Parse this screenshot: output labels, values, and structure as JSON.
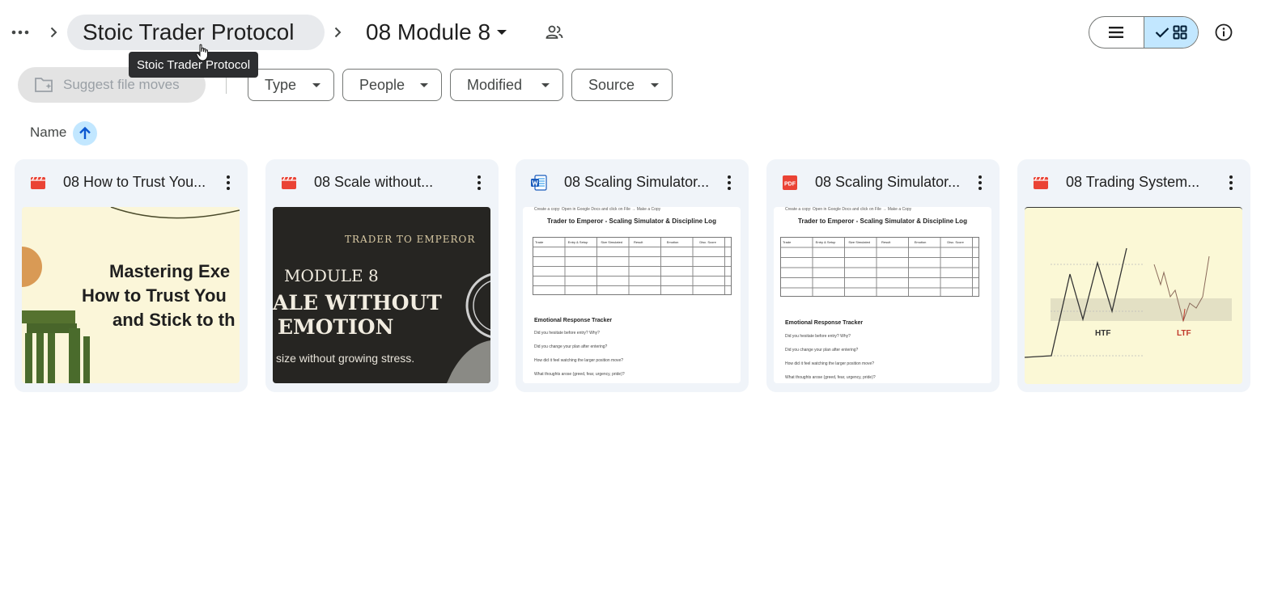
{
  "breadcrumb": {
    "root": "Stoic Trader Protocol",
    "current": "08 Module 8",
    "tooltip": "Stoic Trader Protocol"
  },
  "toolbar": {
    "suggest_label": "Suggest file moves",
    "filters": [
      "Type",
      "People",
      "Modified",
      "Source"
    ]
  },
  "sort": {
    "label": "Name",
    "direction": "ascending"
  },
  "files": [
    {
      "name": "08 How to Trust You...",
      "type": "video",
      "thumb_lines": [
        "Mastering Exe",
        "How to Trust You",
        "and Stick to th"
      ]
    },
    {
      "name": "08 Scale without...",
      "type": "video",
      "thumb_top": "TRADER TO EMPEROR",
      "thumb_lines": [
        "MODULE 8",
        "ALE WITHOUT",
        "EMOTION"
      ],
      "thumb_sub": "size without growing stress."
    },
    {
      "name": "08 Scaling Simulator...",
      "type": "word",
      "doc": {
        "note": "Create a copy: Open in Google Docs and click on File → Make a Copy",
        "title": "Trader to Emperor - Scaling Simulator & Discipline Log",
        "columns": [
          "Trade",
          "Entry & Setup",
          "Size Simulated",
          "Result",
          "Emotion",
          "Disc. Score"
        ],
        "section": "Emotional Response Tracker",
        "questions": [
          "Did you hesitate before entry? Why?",
          "Did you change your plan after entering?",
          "How did it feel watching the larger position move?",
          "What thoughts arose (greed, fear, urgency, pride)?"
        ]
      }
    },
    {
      "name": "08 Scaling Simulator...",
      "type": "pdf",
      "doc": {
        "note": "Create a copy: Open in Google Docs and click on File → Make a Copy",
        "title": "Trader to Emperor - Scaling Simulator & Discipline Log",
        "columns": [
          "Trade",
          "Entry & Setup",
          "Size Simulated",
          "Result",
          "Emotion",
          "Disc. Score"
        ],
        "section": "Emotional Response Tracker",
        "questions": [
          "Did you hesitate before entry? Why?",
          "Did you change your plan after entering?",
          "How did it feel watching the larger position move?",
          "What thoughts arose (greed, fear, urgency, pride)?"
        ]
      }
    },
    {
      "name": "08 Trading System...",
      "type": "video",
      "chart_labels": [
        "HTF",
        "LTF"
      ]
    }
  ],
  "colors": {
    "accent": "#c2e7ff",
    "video_red": "#ea4335",
    "word_blue": "#185abc",
    "pdf_red": "#ea4335",
    "card_bg": "#f0f4f9"
  }
}
